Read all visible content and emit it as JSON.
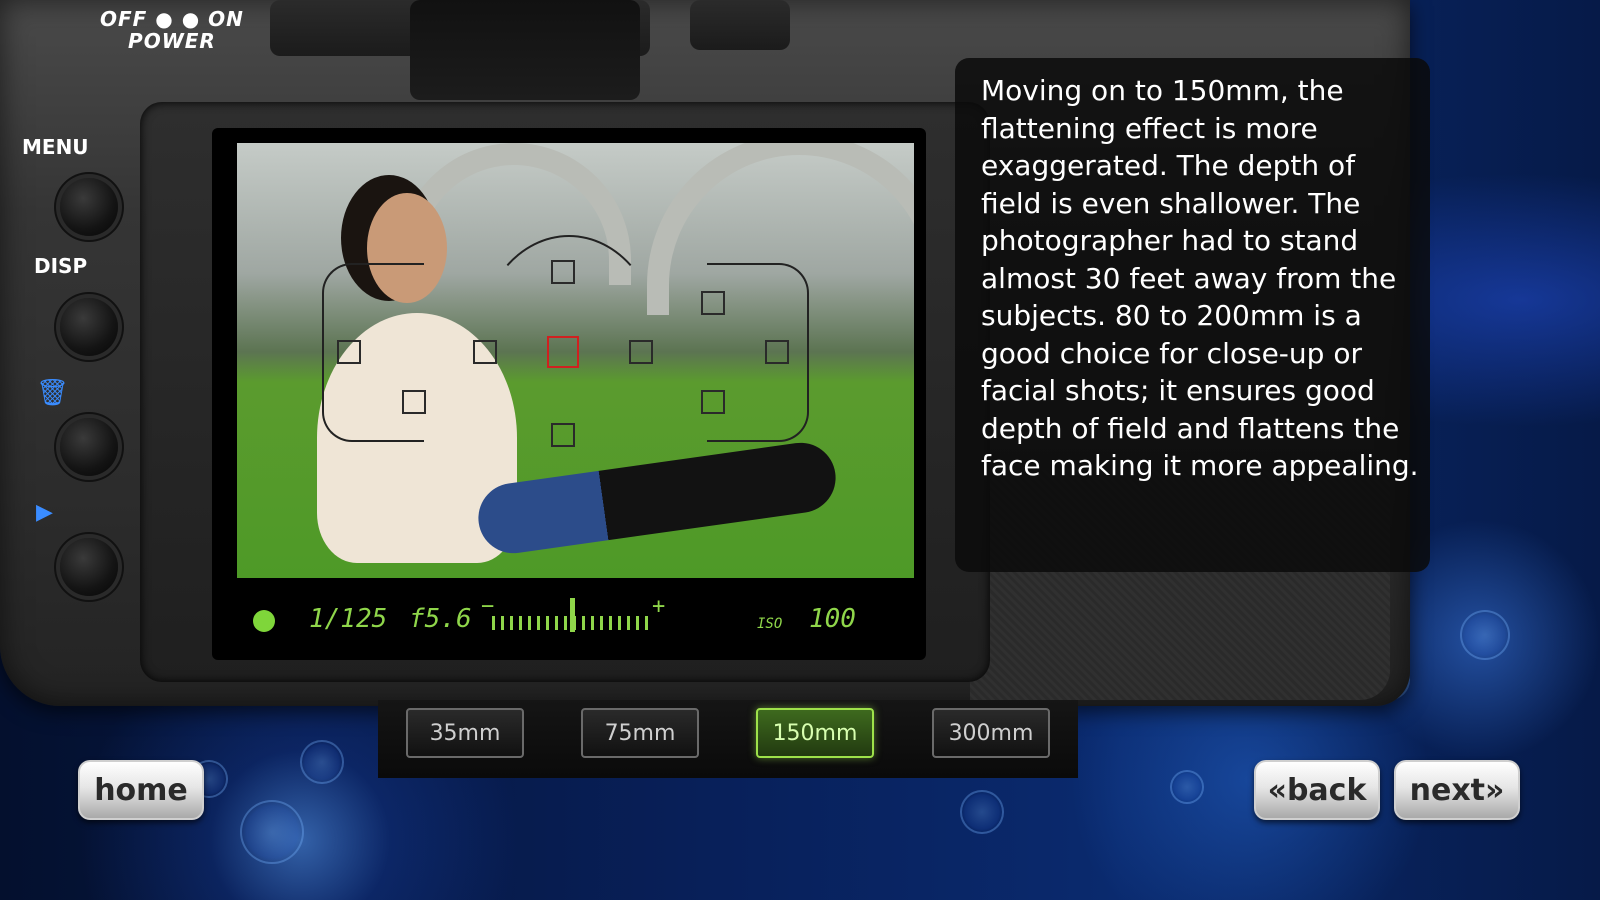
{
  "camera": {
    "power_label_top": "OFF ● ● ON",
    "power_label_bottom": "POWER",
    "menu_label": "MENU",
    "disp_label": "DISP",
    "icons": [
      "trash-icon",
      "playback-icon"
    ]
  },
  "lcd": {
    "shutter": "1/125",
    "aperture": "f5.6",
    "meter_minus": "−",
    "meter_plus": "+",
    "iso_label": "ISO",
    "iso_value": "100"
  },
  "description": "Moving on to 150mm, the flattening effect is more exaggerated. The depth of field is even shallower. The photographer had to stand almost 30 feet away from the subjects. 80 to 200mm is a good choice for close-up or facial shots; it ensures good depth of field and flattens the face making it more appealing.",
  "focal_lengths": {
    "items": [
      {
        "label": "35mm"
      },
      {
        "label": "75mm"
      },
      {
        "label": "150mm"
      },
      {
        "label": "300mm"
      }
    ],
    "selected": "150mm"
  },
  "nav": {
    "home_label": "home",
    "back_label": "«back",
    "next_label": "next»"
  },
  "colors": {
    "lcd_accent": "#8fd64a",
    "af_selected": "#d02020",
    "active_focal": "#9ee24a"
  }
}
